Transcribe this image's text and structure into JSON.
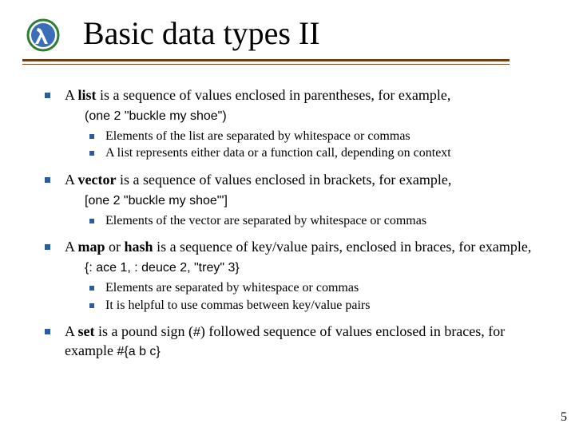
{
  "title": "Basic data types II",
  "bullets": {
    "b1": {
      "text_pre": "A ",
      "bold": "list",
      "text_post": " is a sequence of values enclosed in parentheses, for example,",
      "code": "(one 2 \"buckle my shoe\")",
      "sub": [
        "Elements of the list are separated by whitespace or commas",
        "A list represents either data or a function call, depending on context"
      ]
    },
    "b2": {
      "text_pre": "A ",
      "bold": "vector",
      "text_post": " is a sequence of values enclosed in brackets, for example,",
      "code": "[one 2 \"buckle my shoe\"']",
      "sub": [
        "Elements of the vector are separated by whitespace or commas"
      ]
    },
    "b3": {
      "text_pre": "A ",
      "bold": "map",
      "mid": " or ",
      "bold2": "hash",
      "text_post": " is a sequence of key/value pairs, enclosed in braces, for example,",
      "code": "{: ace 1, : deuce 2, \"trey\" 3}",
      "sub": [
        "Elements are separated by whitespace or commas",
        "It is helpful to use commas between key/value pairs"
      ]
    },
    "b4": {
      "text_pre": "A ",
      "bold": "set",
      "text_post_a": " is a pound sign (",
      "hash": "#",
      "text_post_b": ") followed sequence of values enclosed in braces, for example ",
      "code": "#{a b c}"
    }
  },
  "pagenum": "5"
}
